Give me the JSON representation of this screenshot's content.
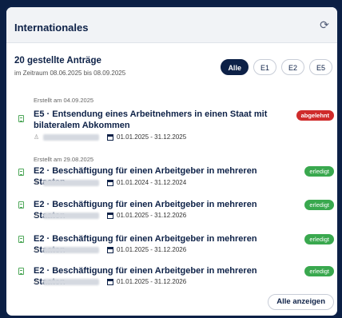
{
  "header": {
    "title": "Internationales",
    "refresh_icon": "refresh-icon"
  },
  "summary": {
    "count_text": "20 gestellte Anträge",
    "range_text": "im Zeitraum 08.06.2025 bis 08.09.2025"
  },
  "filters": [
    {
      "label": "Alle",
      "active": true
    },
    {
      "label": "E1",
      "active": false
    },
    {
      "label": "E2",
      "active": false
    },
    {
      "label": "E5",
      "active": false
    }
  ],
  "items": [
    {
      "created": "Erstellt am 04.09.2025",
      "title": "E5 · Entsendung eines Arbeitnehmers in einen Staat mit bilateralem Abkommen",
      "period": "01.01.2025 - 31.12.2025",
      "status": "abgelehnt",
      "status_color": "#cf2b2b"
    },
    {
      "created": "Erstellt am 29.08.2025",
      "title": "E2 · Beschäftigung für einen Arbeitgeber in mehreren Staaten",
      "period": "01.01.2024 - 31.12.2024",
      "status": "erledigt",
      "status_color": "#39a84e"
    },
    {
      "created": "",
      "title": "E2 · Beschäftigung für einen Arbeitgeber in mehreren Staaten",
      "period": "01.01.2025 - 31.12.2026",
      "status": "erledigt",
      "status_color": "#39a84e"
    },
    {
      "created": "",
      "title": "E2 · Beschäftigung für einen Arbeitgeber in mehreren Staaten",
      "period": "01.01.2025 - 31.12.2026",
      "status": "erledigt",
      "status_color": "#39a84e"
    },
    {
      "created": "",
      "title": "E2 · Beschäftigung für einen Arbeitgeber in mehreren Staaten",
      "period": "01.01.2025 - 31.12.2026",
      "status": "erledigt",
      "status_color": "#39a84e"
    }
  ],
  "footer": {
    "show_all_label": "Alle anzeigen"
  }
}
